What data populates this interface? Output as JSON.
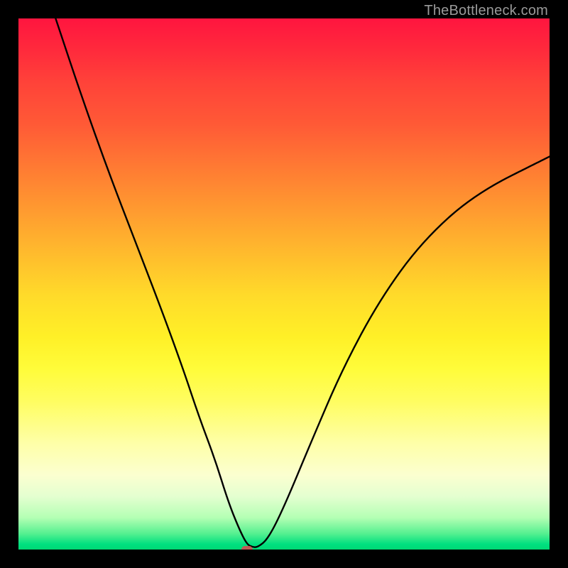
{
  "watermark": "TheBottleneck.com",
  "chart_data": {
    "type": "line",
    "title": "",
    "xlabel": "",
    "ylabel": "",
    "xlim": [
      0,
      100
    ],
    "ylim": [
      0,
      100
    ],
    "grid": false,
    "legend": false,
    "marker": {
      "x": 43,
      "y": 0
    },
    "series": [
      {
        "name": "curve",
        "x": [
          7,
          12,
          17,
          22,
          27,
          31,
          34,
          37,
          39.5,
          41.5,
          43,
          44,
          45,
          47,
          50,
          55,
          61,
          68,
          76,
          86,
          100
        ],
        "y": [
          100,
          85,
          71,
          58,
          45,
          34,
          25,
          17,
          9,
          4,
          1,
          0.5,
          0.4,
          2,
          8,
          20,
          34,
          47,
          58,
          67,
          74
        ]
      }
    ],
    "background_gradient": {
      "top_color": "#ff153f",
      "bottom_color": "#00d874"
    }
  }
}
